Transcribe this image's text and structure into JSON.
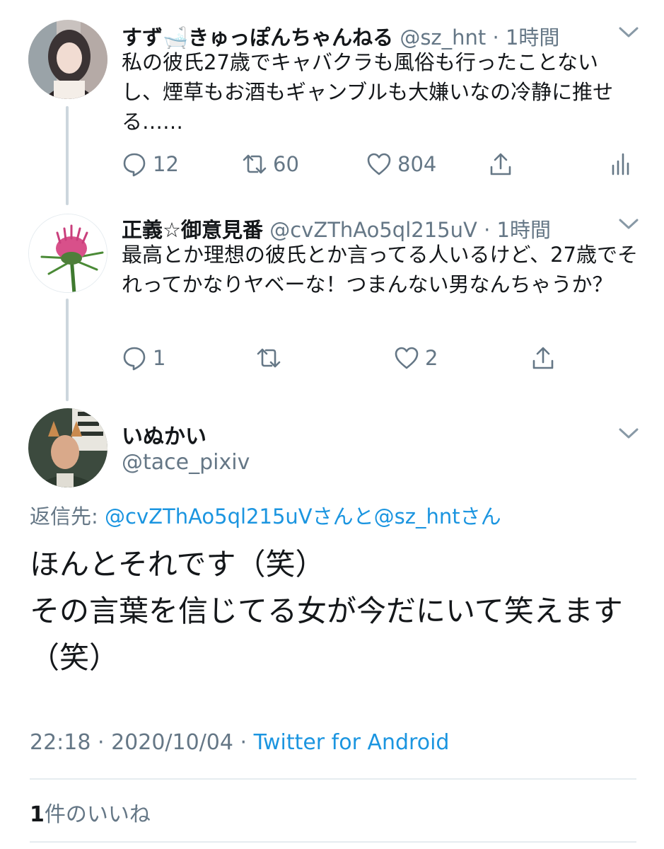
{
  "tweets": [
    {
      "name": "すず🛁きゅっぽんちゃんねる",
      "handle": "@sz_hnt",
      "time": "· 1時間",
      "text": "私の彼氏27歳でキャバクラも風俗も行ったことないし、煙草もお酒もギャンブルも大嫌いなの冷静に推せる……",
      "replies": "12",
      "retweets": "60",
      "likes": "804"
    },
    {
      "name": "正義☆御意見番",
      "handle": "@cvZThAo5ql215uV",
      "time": "· 1時間",
      "text": "最高とか理想の彼氏とか言ってる人いるけど、27歳でそれってかなりヤベーな！つまんない男なんちゃうか？",
      "replies": "1",
      "retweets": "",
      "likes": "2"
    }
  ],
  "main": {
    "name": "いぬかい",
    "handle": "@tace_pixiv",
    "reply_prefix": "返信先: ",
    "reply_links": "@cvZThAo5ql215uVさんと@sz_hntさん",
    "text_line1": "ほんとそれです（笑）",
    "text_line2": "その言葉を信じてる女が今だにいて笑えます（笑）",
    "meta_time": "22:18 · 2020/10/04 · ",
    "meta_source": "Twitter for Android",
    "likes_count": "1",
    "likes_label": "件のいいね"
  },
  "colors": {
    "link": "#1b95e0",
    "secondary": "#657786",
    "thread_line": "#ccd6dd"
  }
}
